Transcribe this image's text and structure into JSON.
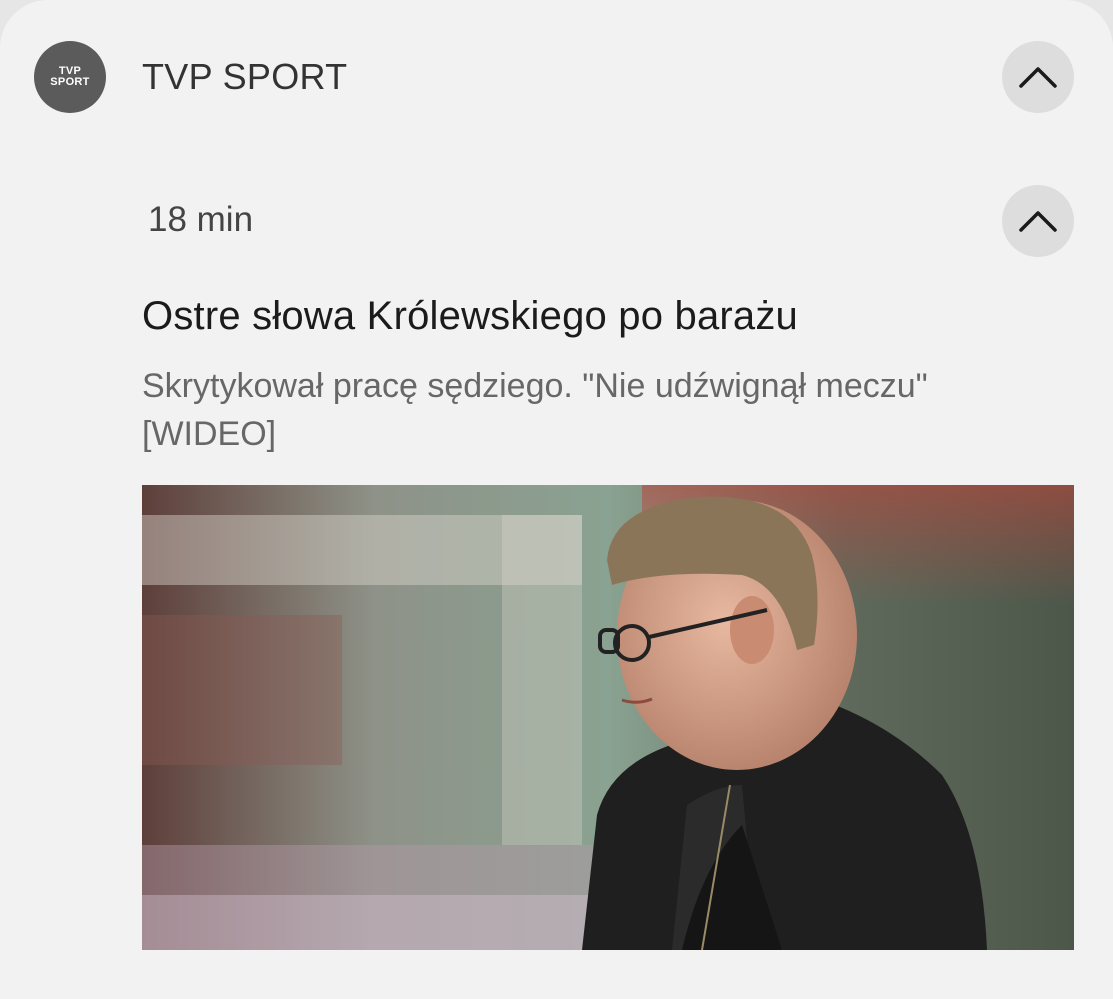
{
  "app": {
    "icon_line1": "TVP",
    "icon_line2": "SPORT",
    "name": "TVP SPORT"
  },
  "notification": {
    "time": "18 min",
    "title": "Ostre słowa Królewskiego po barażu",
    "body": "Skrytykował pracę sędziego. \"Nie udźwignął meczu\" [WIDEO]"
  },
  "icons": {
    "collapse_app": "chevron-up-icon",
    "collapse_notification": "chevron-up-icon"
  },
  "colors": {
    "background": "#f2f2f2",
    "icon_bg": "#5b5b5b",
    "button_bg": "#dddddd"
  }
}
